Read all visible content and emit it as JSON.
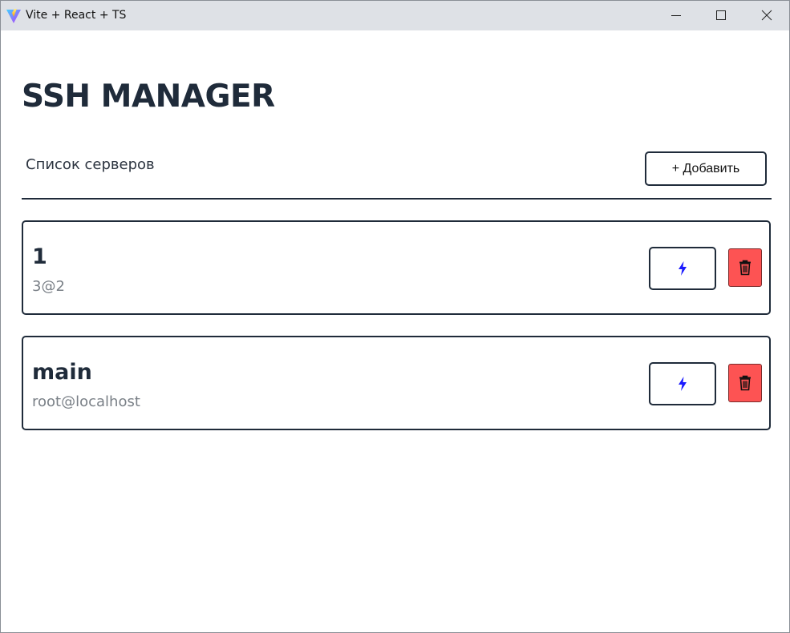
{
  "window": {
    "title": "Vite + React + TS",
    "logo_icon": "vite-logo-icon",
    "controls": [
      "minimize-icon",
      "maximize-icon",
      "close-icon"
    ]
  },
  "app": {
    "title": "SSH MANAGER",
    "list_label": "Список серверов",
    "add_button_label": "+ Добавить"
  },
  "servers": [
    {
      "name": "1",
      "address": "3@2",
      "connect_icon": "lightning-icon",
      "delete_icon": "trash-icon"
    },
    {
      "name": "main",
      "address": "root@localhost",
      "connect_icon": "lightning-icon",
      "delete_icon": "trash-icon"
    }
  ],
  "colors": {
    "text_dark": "#1f2b3a",
    "text_muted": "#7a8087",
    "delete_bg": "#fd5353",
    "connect_icon": "#1a1aff",
    "titlebar_bg": "#dee1e6"
  }
}
